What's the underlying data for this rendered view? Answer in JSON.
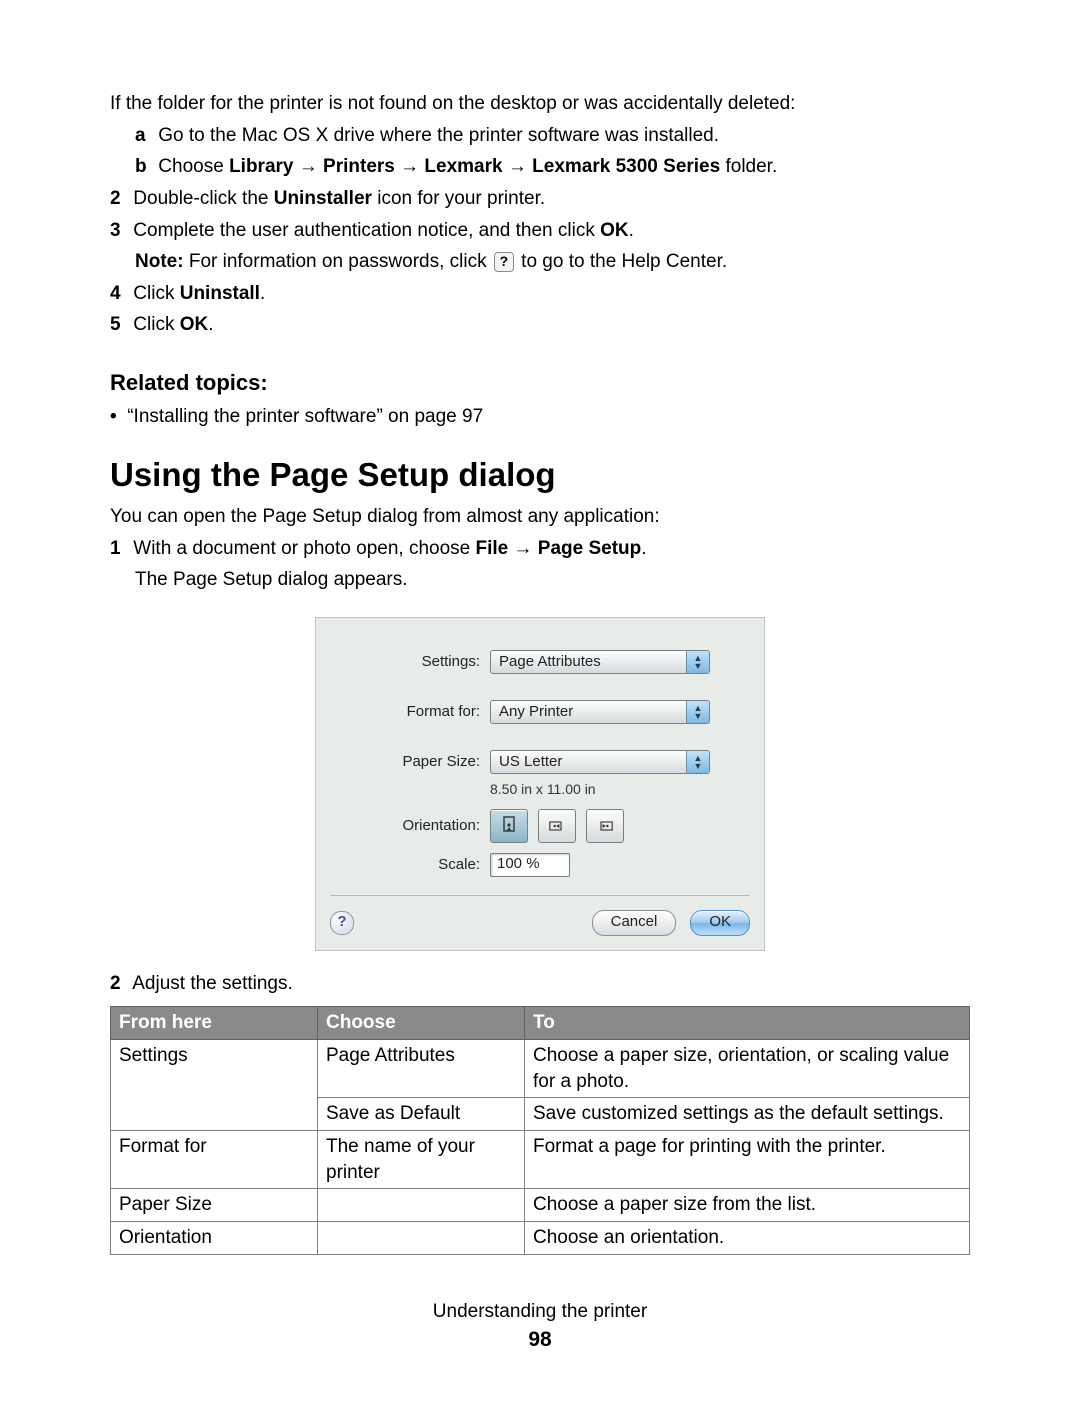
{
  "intro": "If the folder for the printer is not found on the desktop or was accidentally deleted:",
  "sub_a_prefix": "Go to the Mac OS X drive where the printer software was installed.",
  "sub_b_prefix": "Choose ",
  "sub_b_bold1": "Library",
  "sub_b_bold2": "Printers",
  "sub_b_bold3": "Lexmark",
  "sub_b_bold4": "Lexmark 5300 Series",
  "sub_b_suffix": " folder.",
  "step2_a": "Double-click the ",
  "step2_b": "Uninstaller",
  "step2_c": " icon for your printer.",
  "step3_a": "Complete the user authentication notice, and then click ",
  "step3_b": "OK",
  "step3_c": ".",
  "note_a": "Note:",
  "note_b": " For information on passwords, click ",
  "note_c": " to go to the Help Center.",
  "step4_a": "Click ",
  "step4_b": "Uninstall",
  "step4_c": ".",
  "step5_a": "Click ",
  "step5_b": "OK",
  "step5_c": ".",
  "related_heading": "Related topics:",
  "related_item": "“Installing the printer software” on page 97",
  "h1": "Using the Page Setup dialog",
  "h1_para": "You can open the Page Setup dialog from almost any application:",
  "ps_step1_a": "With a document or photo open, choose ",
  "ps_step1_b": "File",
  "ps_step1_c": "Page Setup",
  "ps_step1_d": ".",
  "ps_step1_line2": "The Page Setup dialog appears.",
  "dialog": {
    "settings_label": "Settings:",
    "settings_value": "Page Attributes",
    "format_label": "Format for:",
    "format_value": "Any Printer",
    "paper_label": "Paper Size:",
    "paper_value": "US Letter",
    "paper_dim": "8.50 in x 11.00 in",
    "orientation_label": "Orientation:",
    "scale_label": "Scale:",
    "scale_value": "100 %",
    "help": "?",
    "cancel": "Cancel",
    "ok": "OK"
  },
  "ps_step2": "Adjust the settings.",
  "table": {
    "h1": "From here",
    "h2": "Choose",
    "h3": "To",
    "r1c1": "Settings",
    "r1c2": "Page Attributes",
    "r1c3": "Choose a paper size, orientation, or scaling value for a photo.",
    "r2c2": "Save as Default",
    "r2c3": "Save customized settings as the default settings.",
    "r3c1": "Format for",
    "r3c2": "The name of your printer",
    "r3c3": "Format a page for printing with the printer.",
    "r4c1": "Paper Size",
    "r4c3": "Choose a paper size from the list.",
    "r5c1": "Orientation",
    "r5c3": "Choose an orientation."
  },
  "footer_text": "Understanding the printer",
  "page_number": "98"
}
